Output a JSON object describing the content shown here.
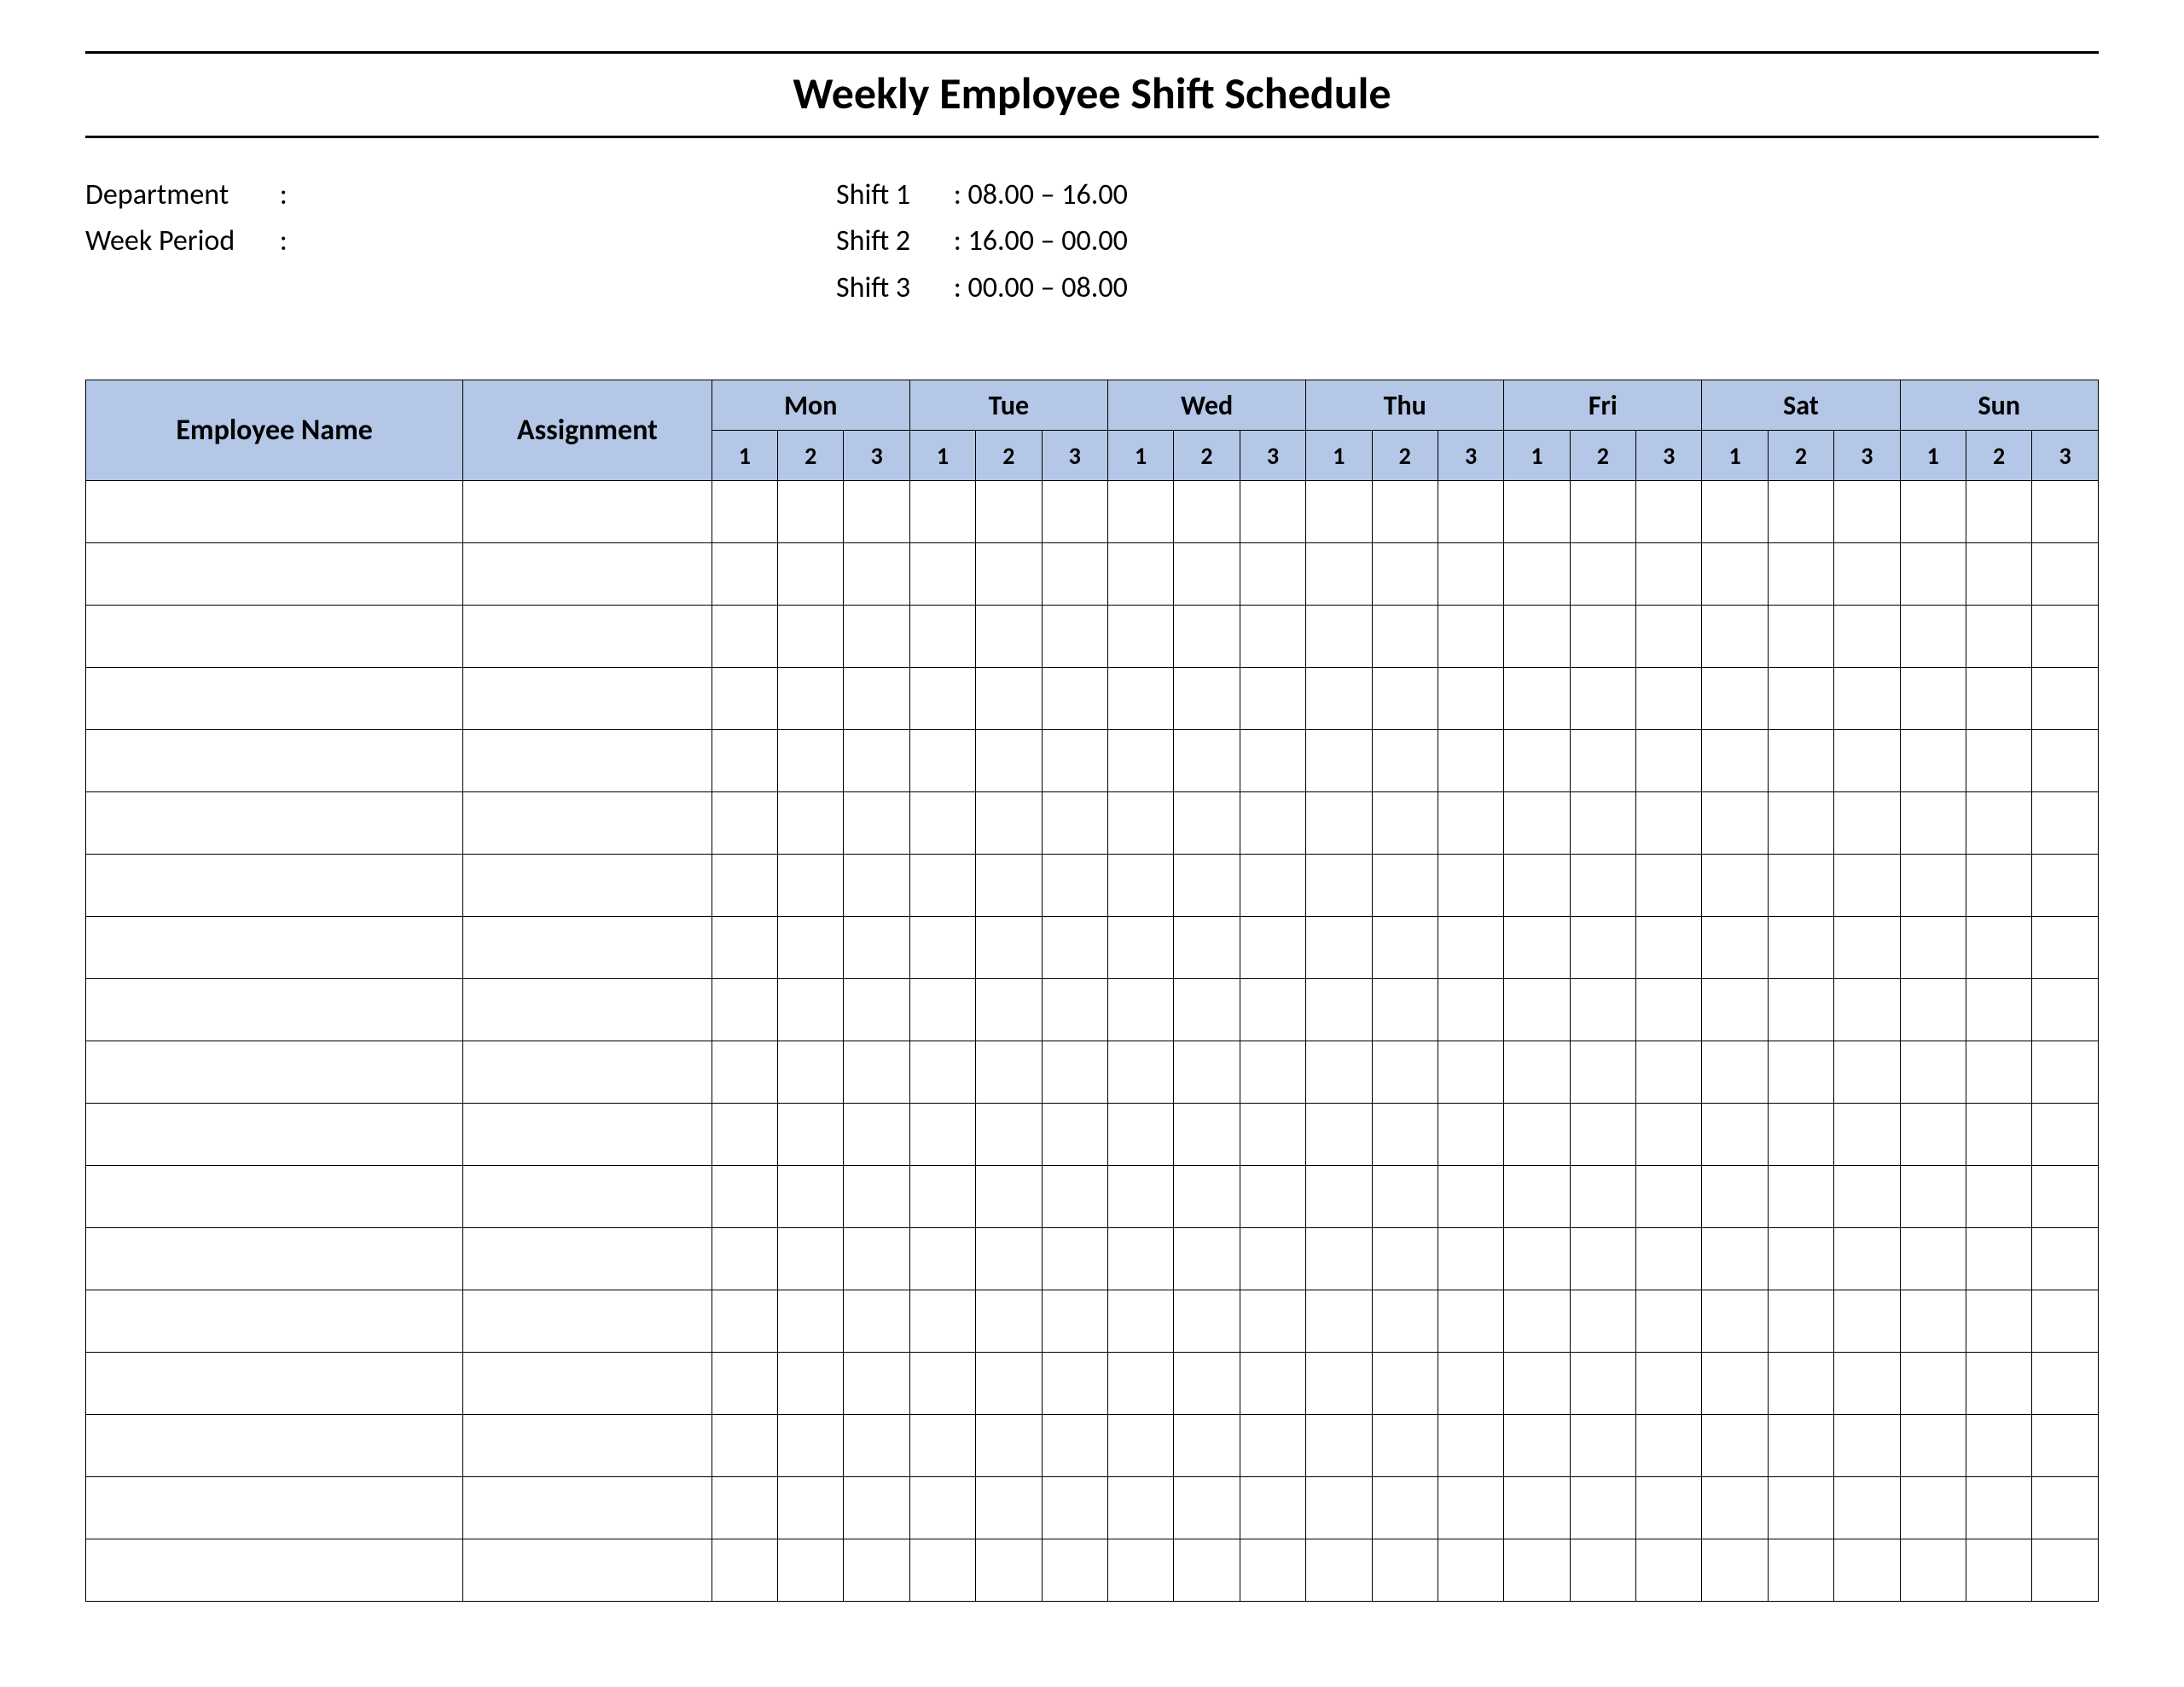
{
  "title": "Weekly Employee Shift Schedule",
  "meta": {
    "department_label": "Department",
    "department_value": "",
    "week_period_label": "Week  Period",
    "week_period_value": "",
    "shifts": [
      {
        "label": "Shift 1",
        "time": "08.00  – 16.00"
      },
      {
        "label": "Shift 2",
        "time": "16.00  – 00.00"
      },
      {
        "label": "Shift 3",
        "time": "00.00  – 08.00"
      }
    ]
  },
  "table": {
    "headers": {
      "employee": "Employee Name",
      "assignment": "Assignment",
      "days": [
        "Mon",
        "Tue",
        "Wed",
        "Thu",
        "Fri",
        "Sat",
        "Sun"
      ],
      "sub": [
        "1",
        "2",
        "3"
      ]
    },
    "row_count": 18
  }
}
